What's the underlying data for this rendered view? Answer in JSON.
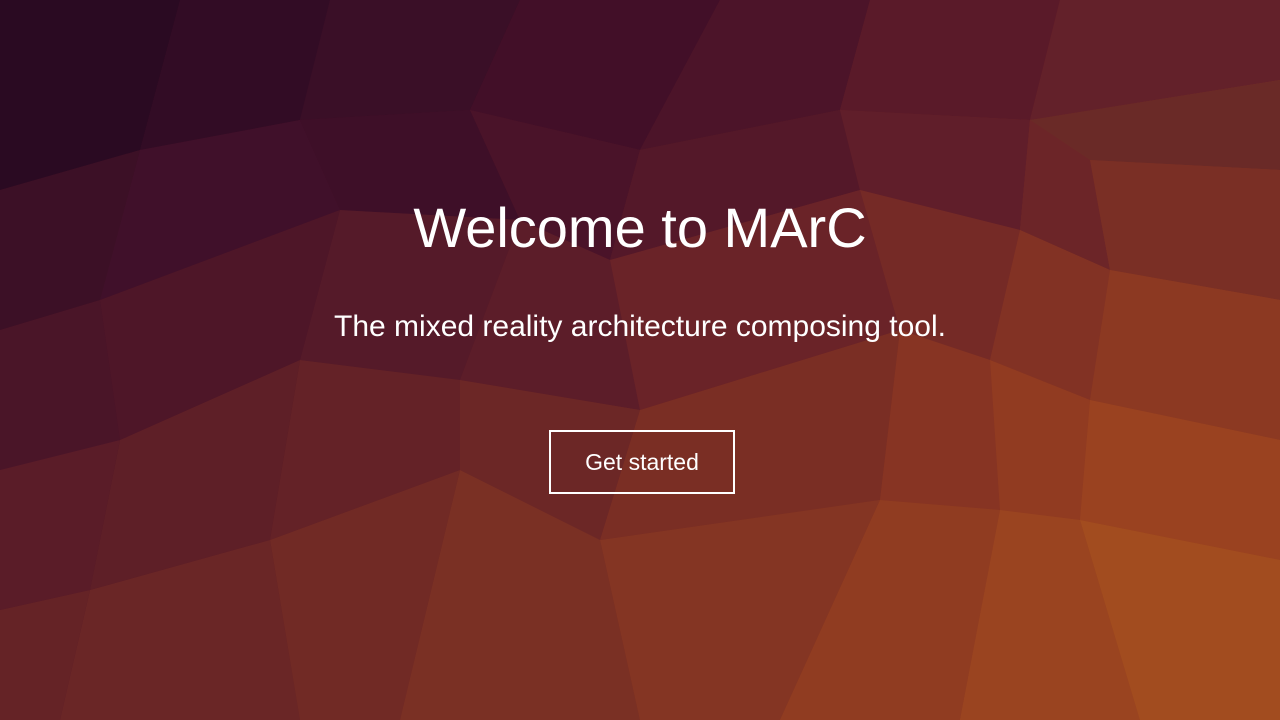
{
  "hero": {
    "title": "Welcome to MArC",
    "subtitle": "The mixed reality architecture composing tool.",
    "cta_label": "Get started"
  },
  "colors": {
    "background_dark": "#2e0a24",
    "background_mid": "#6e2426",
    "background_light": "#a4521f",
    "text": "#ffffff",
    "button_border": "#ffffff"
  }
}
